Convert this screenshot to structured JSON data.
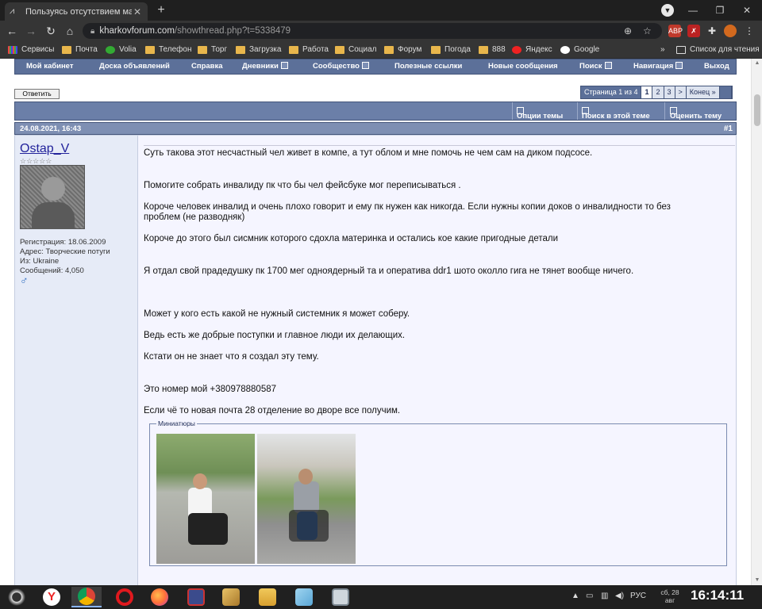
{
  "browser": {
    "tab_title": "Пользуясь отсутствием мардер",
    "new_tab": "+",
    "url_host": "kharkovforum.com",
    "url_path": "/showthread.php?t=5338479",
    "bookmarks": [
      "Сервисы",
      "Почта",
      "Volia",
      "Телефон",
      "Торг",
      "Загрузка",
      "Работа",
      "Социал",
      "Форум",
      "Погода",
      "888",
      "Яндекс",
      "Google"
    ],
    "more_bookmarks": "»",
    "reading_list": "Список для чтения"
  },
  "forum": {
    "nav": [
      "Мой кабинет",
      "Доска объявлений",
      "Справка",
      "Дневники",
      "Сообщество",
      "Полезные ссылки",
      "Новые сообщения",
      "Поиск",
      "Навигация",
      "Выход"
    ],
    "reply_button": "Ответить",
    "pager": {
      "label": "Страница 1 из 4",
      "pages": [
        "1",
        "2",
        "3"
      ],
      "next": ">",
      "last": "Конец »"
    },
    "thread_tools": [
      "Опции темы",
      "Поиск в этой теме",
      "Оценить тему"
    ],
    "post": {
      "date": "24.08.2021, 16:43",
      "number": "#1",
      "username": "Ostap_V",
      "stars": "☆☆☆☆☆",
      "registration": "Регистрация: 18.06.2009",
      "address": "Адрес: Творческие потуги",
      "from": "Из: Ukraine",
      "messages": "Сообщений: 4,050",
      "gender_icon": "♂",
      "lines": [
        "Суть такова этот несчастный чел живет в компе, а тут облом и мне помочь не чем сам на диком подсосе.",
        "Помогите собрать инвалиду пк что бы чел фейсбуке мог переписываться .",
        "Короче человек инвалид и очень плохо говорит и ему пк нужен как никогда. Если нужны копии доков о инвалидности то без",
        "проблем (не разводняк)",
        "Короче до этого был сисмник которого сдохла материнка и остались кое какие пригодные детали",
        "Я отдал свой прадедушку пк 1700 мег одноядерный та и оператива ddr1 шото околло гига не тянет вообще ничего.",
        "Может у кого есть какой не нужный системник я может соберу.",
        "Ведь есть же добрые поступки и главное люди их делающих.",
        "Кстати он не знает что я создал эту тему.",
        "Это номер мой +380978880587",
        "Если чё то новая почта 28 отделение во дворе все получим."
      ],
      "thumbnails_label": "Миниатюры"
    }
  },
  "taskbar": {
    "lang": "РУС",
    "date_day": "сб, 28",
    "date_month": "авг",
    "time": "16:14:11"
  },
  "colors": {
    "nav_blue": "#5c7099",
    "header_blue": "#6b7fa8",
    "user_pane": "#e6ebf7"
  }
}
